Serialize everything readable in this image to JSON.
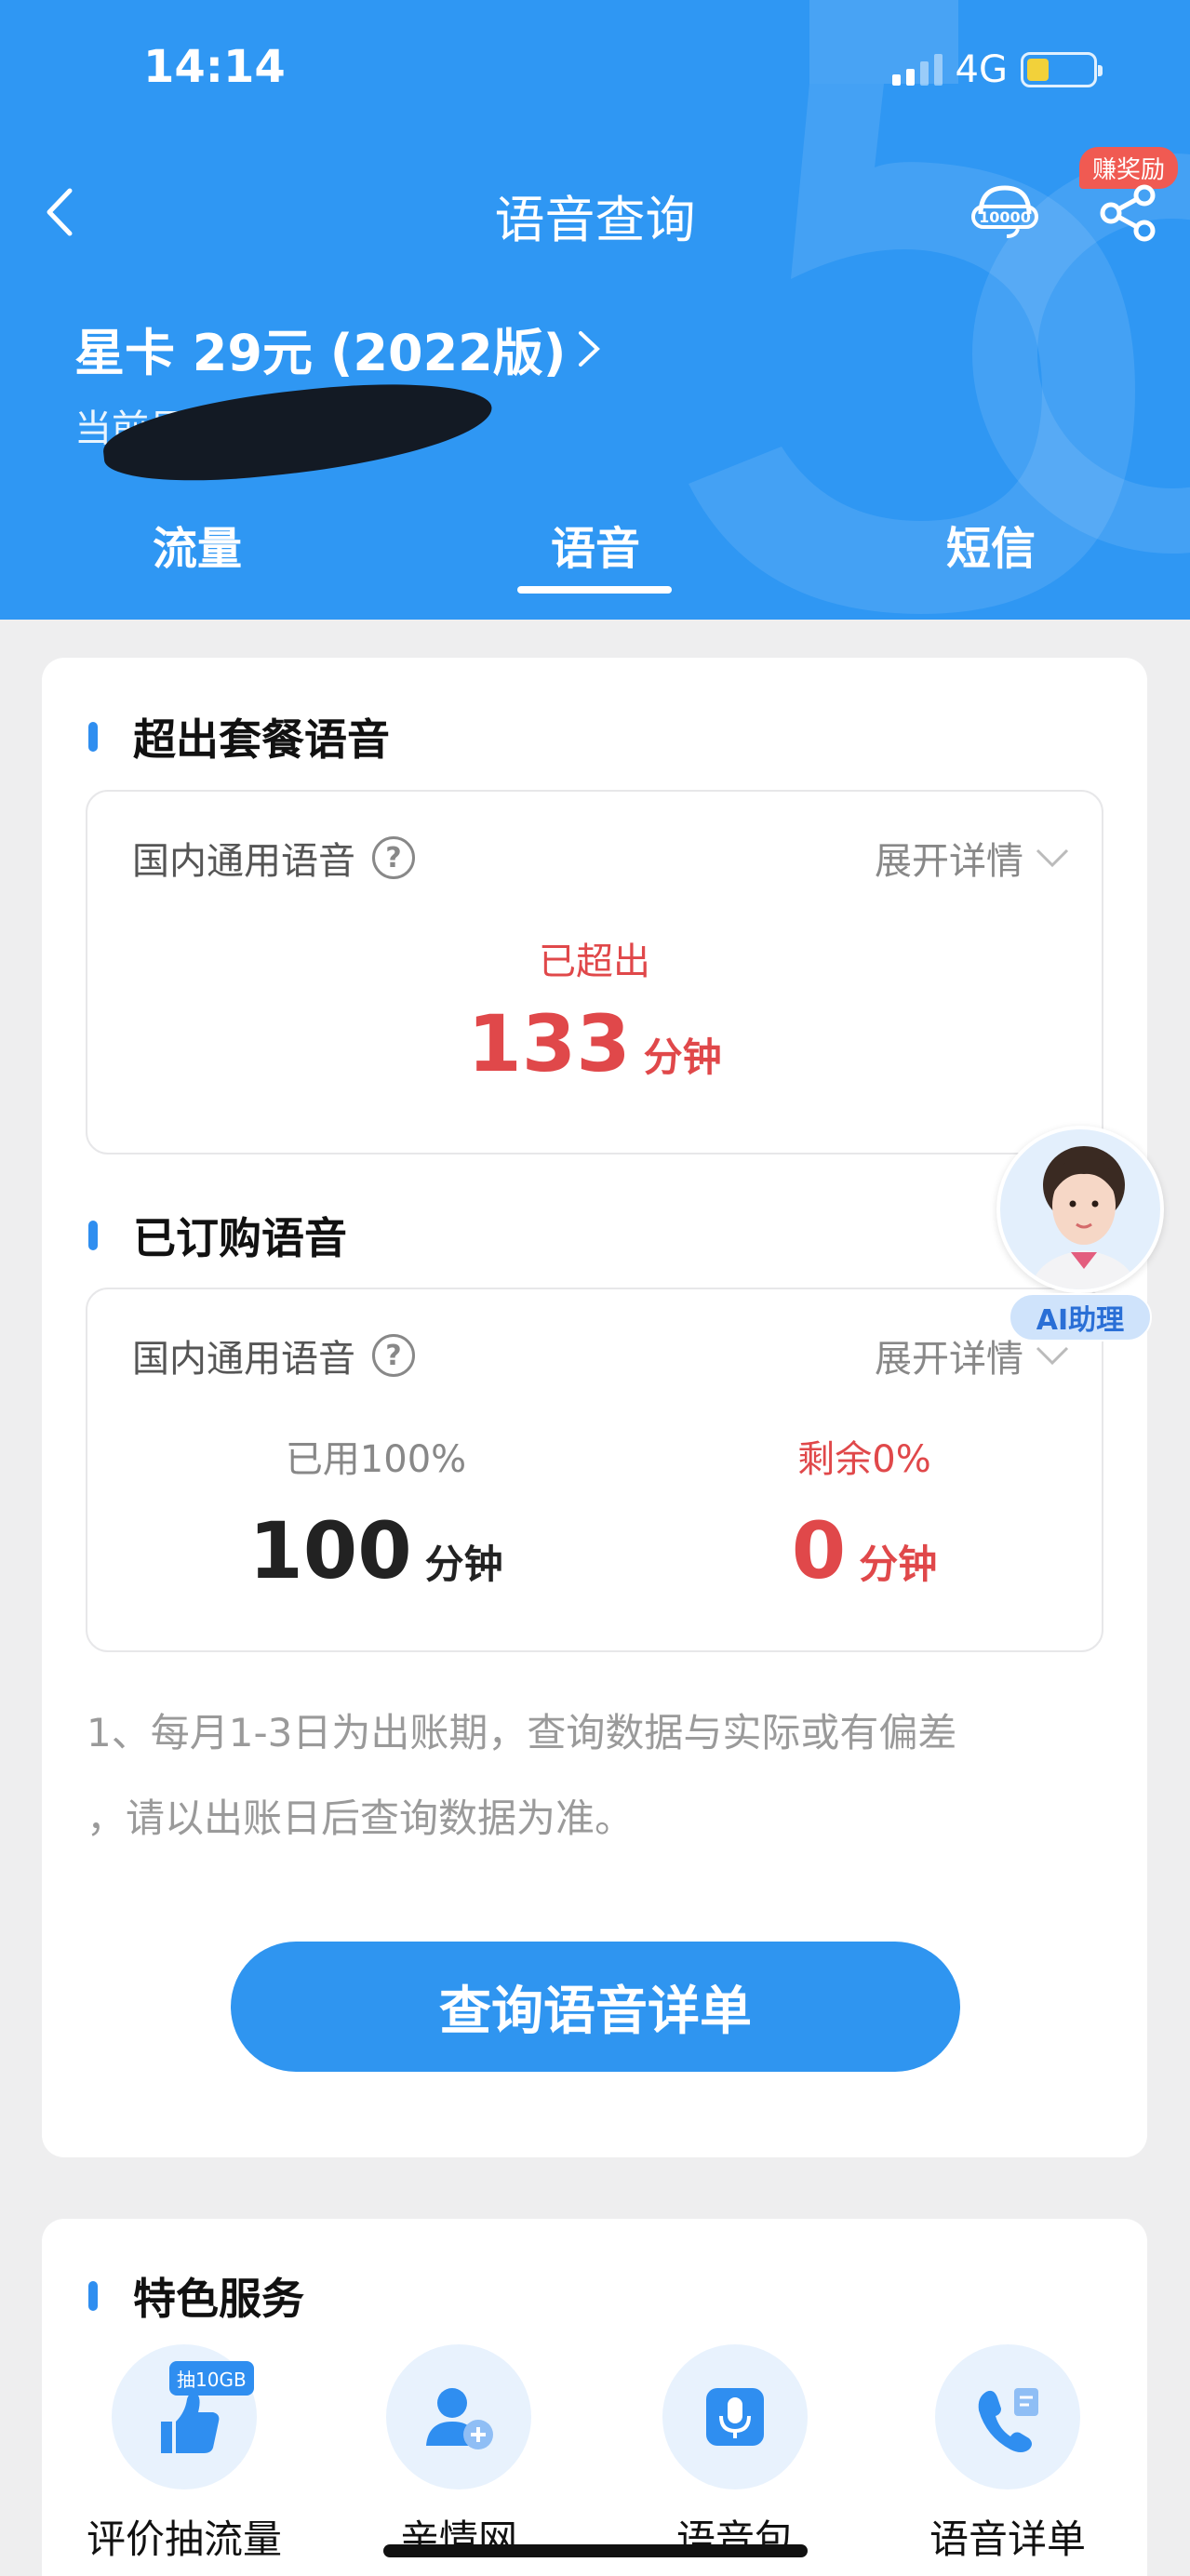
{
  "status": {
    "time": "14:14",
    "network": "4G"
  },
  "nav": {
    "title": "语音查询",
    "reward_badge": "赚奖励"
  },
  "plan": {
    "name": "星卡 29元 (2022版)",
    "number_label": "当前号码"
  },
  "tabs": [
    {
      "label": "流量",
      "active": false
    },
    {
      "label": "语音",
      "active": true
    },
    {
      "label": "短信",
      "active": false
    }
  ],
  "sections": {
    "over": {
      "title": "超出套餐语音",
      "box_label": "国内通用语音",
      "expand_label": "展开详情",
      "caption": "已超出",
      "value": "133",
      "unit": "分钟"
    },
    "ordered": {
      "title": "已订购语音",
      "box_label": "国内通用语音",
      "expand_label": "展开详情",
      "used_caption": "已用100%",
      "used_value": "100",
      "used_unit": "分钟",
      "left_caption": "剩余0%",
      "left_value": "0",
      "left_unit": "分钟"
    }
  },
  "note_line1": "1、每月1-3日为出账期，查询数据与实际或有偏差",
  "note_line2": "，请以出账日后查询数据为准。",
  "query_button": "查询语音详单",
  "ai_label": "AI助理",
  "services": {
    "title": "特色服务",
    "items": [
      {
        "label": "评价抽流量",
        "icon": "thumbs-up-icon",
        "tag": "抽10GB"
      },
      {
        "label": "亲情网",
        "icon": "add-family-icon"
      },
      {
        "label": "语音包",
        "icon": "microphone-icon"
      },
      {
        "label": "语音详单",
        "icon": "phone-list-icon"
      }
    ]
  },
  "colors": {
    "header_blue": "#2f97f3",
    "button_blue": "#2f95f0",
    "alert_red": "#e0484a",
    "accent_bar": "#2f8ef0"
  }
}
